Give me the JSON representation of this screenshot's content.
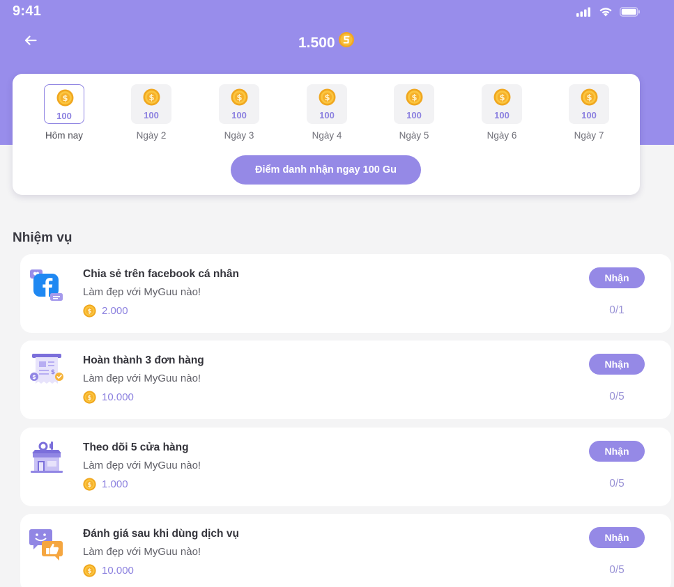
{
  "status_bar": {
    "time": "9:41",
    "icons": [
      "signal-icon",
      "wifi-icon",
      "battery-icon"
    ]
  },
  "header": {
    "back_icon": "arrow-left-icon",
    "balance": "1.500",
    "currency_icon": "gu-coin-icon"
  },
  "checkin": {
    "days": [
      {
        "label": "Hôm nay",
        "reward": "100",
        "today": true
      },
      {
        "label": "Ngày 2",
        "reward": "100",
        "today": false
      },
      {
        "label": "Ngày 3",
        "reward": "100",
        "today": false
      },
      {
        "label": "Ngày 4",
        "reward": "100",
        "today": false
      },
      {
        "label": "Ngày 5",
        "reward": "100",
        "today": false
      },
      {
        "label": "Ngày 6",
        "reward": "100",
        "today": false
      },
      {
        "label": "Ngày 7",
        "reward": "100",
        "today": false
      }
    ],
    "button_label": "Điểm danh nhận ngay 100 Gu"
  },
  "tasks_section": {
    "title": "Nhiệm vụ",
    "tasks": [
      {
        "icon": "facebook-share-icon",
        "title": "Chia sẻ trên facebook cá nhân",
        "description": "Làm đẹp với MyGuu nào!",
        "reward": "2.000",
        "button_label": "Nhận",
        "progress": "0/1"
      },
      {
        "icon": "order-receipt-icon",
        "title": "Hoàn thành 3 đơn hàng",
        "description": "Làm đẹp với MyGuu nào!",
        "reward": "10.000",
        "button_label": "Nhận",
        "progress": "0/5"
      },
      {
        "icon": "store-icon",
        "title": "Theo dõi 5 cửa hàng",
        "description": "Làm đẹp với MyGuu nào!",
        "reward": "1.000",
        "button_label": "Nhận",
        "progress": "0/5"
      },
      {
        "icon": "review-chat-icon",
        "title": "Đánh giá sau khi dùng dịch vụ",
        "description": "Làm đẹp với MyGuu nào!",
        "reward": "10.000",
        "button_label": "Nhận",
        "progress": "0/5"
      }
    ]
  },
  "colors": {
    "primary": "#988deb",
    "button": "#9589e6",
    "coin": "#f7b524",
    "background": "#f4f4f5"
  }
}
